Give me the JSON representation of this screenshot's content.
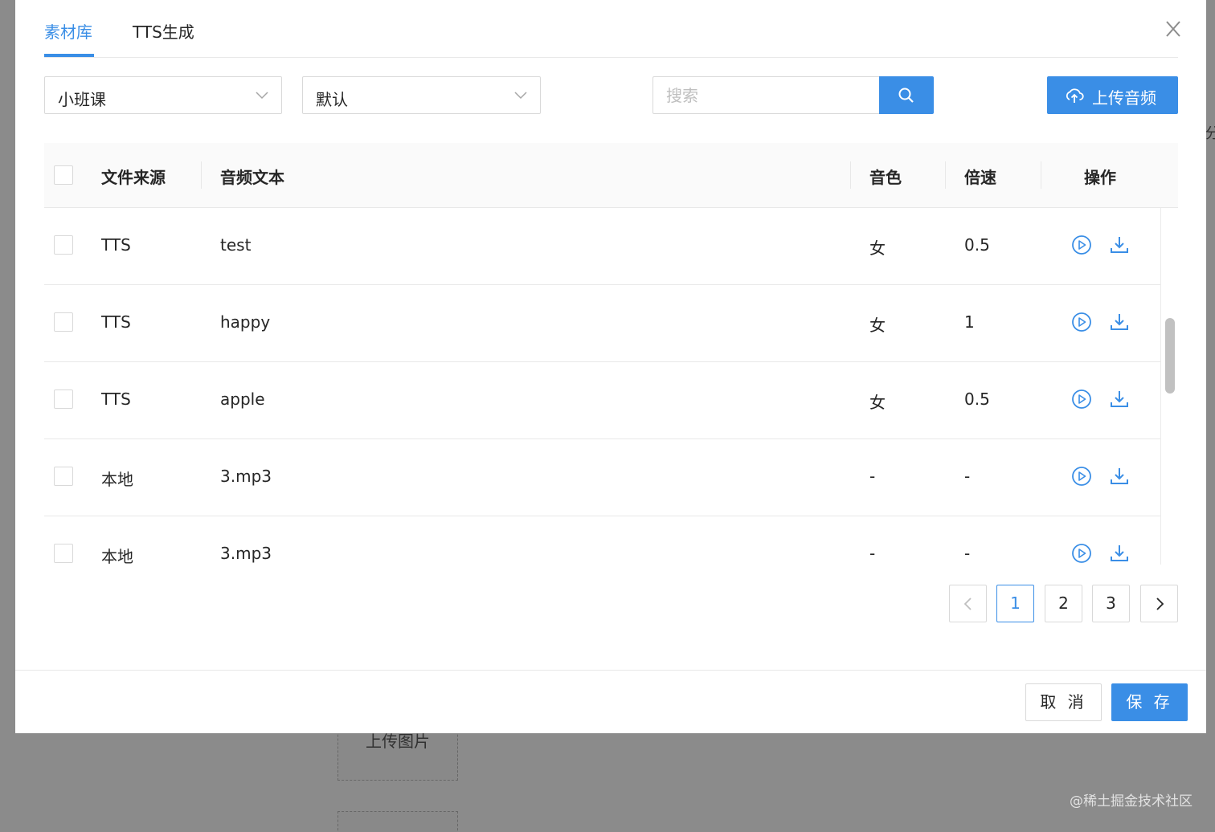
{
  "background": {
    "upload_image_label": "上传图片",
    "edge_char": "分",
    "watermark": "@稀土掘金技术社区"
  },
  "modal": {
    "tabs": [
      {
        "label": "素材库",
        "active": true
      },
      {
        "label": "TTS生成",
        "active": false
      }
    ],
    "close_icon": "close-icon"
  },
  "filters": {
    "category": {
      "value": "小班课"
    },
    "voice": {
      "value": "默认"
    },
    "search": {
      "placeholder": "搜索",
      "value": ""
    },
    "upload_label": "上传音频"
  },
  "table": {
    "columns": [
      "文件来源",
      "音频文本",
      "音色",
      "倍速",
      "操作"
    ],
    "rows": [
      {
        "source": "TTS",
        "text": "test",
        "voice": "女",
        "speed": "0.5"
      },
      {
        "source": "TTS",
        "text": "happy",
        "voice": "女",
        "speed": "1"
      },
      {
        "source": "TTS",
        "text": "apple",
        "voice": "女",
        "speed": "0.5"
      },
      {
        "source": "本地",
        "text": "3.mp3",
        "voice": "-",
        "speed": "-"
      },
      {
        "source": "本地",
        "text": "3.mp3",
        "voice": "-",
        "speed": "-"
      }
    ],
    "row_actions": [
      "play-icon",
      "download-icon"
    ]
  },
  "pagination": {
    "pages": [
      "1",
      "2",
      "3"
    ],
    "current": "1"
  },
  "footer": {
    "cancel_label": "取 消",
    "save_label": "保 存"
  },
  "colors": {
    "accent": "#3a8ee6"
  }
}
